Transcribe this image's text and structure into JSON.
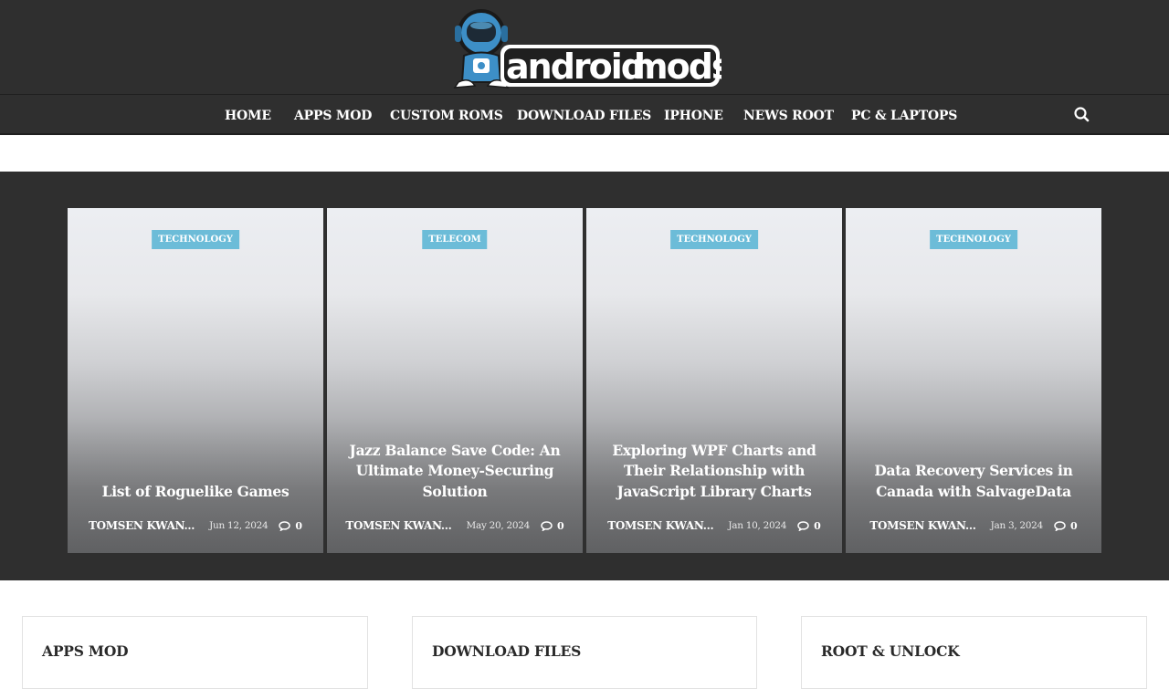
{
  "brand": {
    "name_part1": "android",
    "name_part2": "mods",
    "colors": {
      "header_bg": "#2f2f2f",
      "badge": "#6cbcd8",
      "mascot": "#3d8fc7"
    }
  },
  "nav": {
    "items": [
      {
        "label": "HOME"
      },
      {
        "label": "APPS MOD"
      },
      {
        "label": "CUSTOM ROMS"
      },
      {
        "label": "DOWNLOAD FILES"
      },
      {
        "label": "IPHONE"
      },
      {
        "label": "NEWS ROOT"
      },
      {
        "label": "PC & LAPTOPS"
      }
    ],
    "search_icon": "search-icon"
  },
  "posts": [
    {
      "category": "TECHNOLOGY",
      "title": "List of Roguelike Games",
      "author": "TOMSEN KWAN...",
      "date": "Jun 12, 2024",
      "comments": "0"
    },
    {
      "category": "TELECOM",
      "title": "Jazz Balance Save Code: An Ultimate Money-Securing Solution",
      "author": "TOMSEN KWAN...",
      "date": "May 20, 2024",
      "comments": "0"
    },
    {
      "category": "TECHNOLOGY",
      "title": "Exploring WPF Charts and Their Relationship with JavaScript Library Charts",
      "author": "TOMSEN KWAN...",
      "date": "Jan 10, 2024",
      "comments": "0"
    },
    {
      "category": "TECHNOLOGY",
      "title": "Data Recovery Services in Canada with SalvageData",
      "author": "TOMSEN KWAN...",
      "date": "Jan 3, 2024",
      "comments": "0"
    }
  ],
  "widgets": [
    {
      "title": "APPS MOD"
    },
    {
      "title": "DOWNLOAD FILES"
    },
    {
      "title": "ROOT & UNLOCK"
    }
  ]
}
